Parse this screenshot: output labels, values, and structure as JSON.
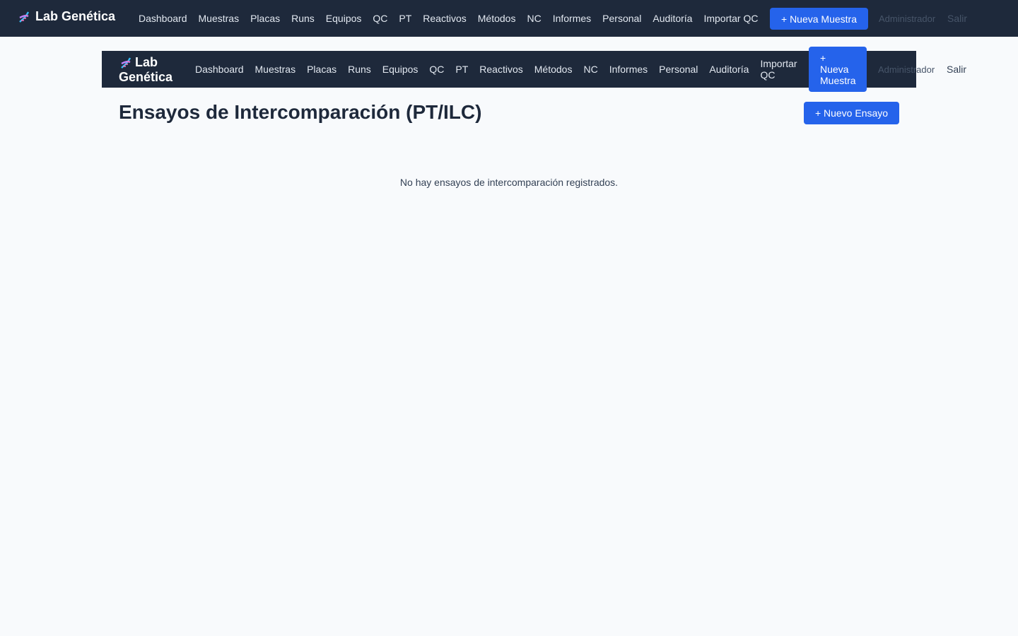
{
  "app": {
    "brand": "Lab Genética",
    "brand_line1": "Lab",
    "brand_line2": "Genética",
    "brand_icon": "dna-icon",
    "accent_color": "#2563eb",
    "nav_bg": "#1e293b"
  },
  "nav": {
    "links": [
      "Dashboard",
      "Muestras",
      "Placas",
      "Runs",
      "Equipos",
      "QC",
      "PT",
      "Reactivos",
      "Métodos",
      "NC",
      "Informes",
      "Personal",
      "Auditoría",
      "Importar QC"
    ],
    "inner_import_line1": "Importar",
    "inner_import_line2": "QC",
    "new_sample_button": "+ Nueva Muestra",
    "new_sample_plus": "+",
    "new_sample_word1": "Nueva",
    "new_sample_word2": "Muestra",
    "user": "Administrador",
    "logout": "Salir"
  },
  "main": {
    "title": "Ensayos de Intercomparación (PT/ILC)",
    "new_button": "+ Nuevo Ensayo",
    "empty_message": "No hay ensayos de intercomparación registrados."
  }
}
